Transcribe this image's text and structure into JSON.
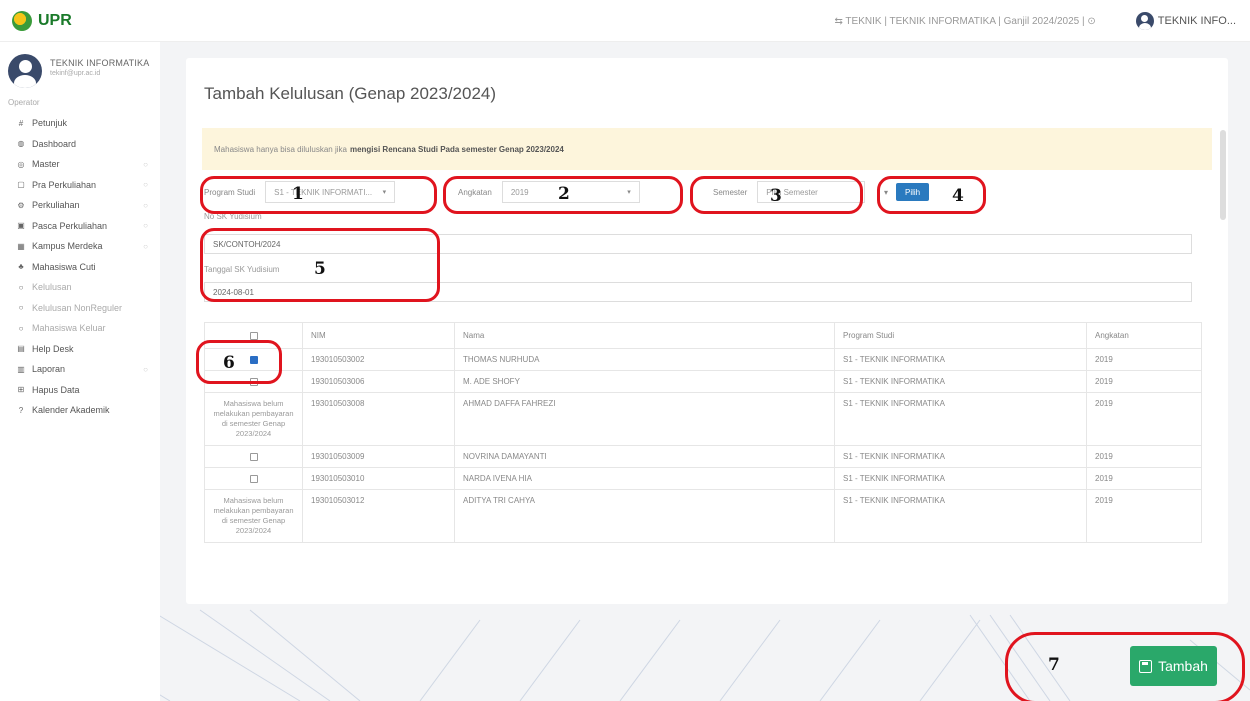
{
  "topbar": {
    "brand": "UPR",
    "info": "⇆ TEKNIK | TEKNIK INFORMATIKA | Ganjil 2024/2025 | ⊙",
    "user": "TEKNIK INFO..."
  },
  "sidebar": {
    "profile_name": "TEKNIK INFORMATIKA",
    "profile_email": "tekinf@upr.ac.id",
    "role": "Operator",
    "items": [
      {
        "icon": "#",
        "label": "Petunjuk",
        "chevron": ""
      },
      {
        "icon": "◍",
        "label": "Dashboard",
        "chevron": ""
      },
      {
        "icon": "◎",
        "label": "Master",
        "chevron": "○"
      },
      {
        "icon": "▢",
        "label": "Pra Perkuliahan",
        "chevron": "○"
      },
      {
        "icon": "⚙",
        "label": "Perkuliahan",
        "chevron": "○"
      },
      {
        "icon": "▣",
        "label": "Pasca Perkuliahan",
        "chevron": "○"
      },
      {
        "icon": "▦",
        "label": "Kampus Merdeka",
        "chevron": "○"
      },
      {
        "icon": "♣",
        "label": "Mahasiswa Cuti",
        "chevron": ""
      },
      {
        "icon": "○",
        "label": "Kelulusan",
        "chevron": ""
      },
      {
        "icon": "○",
        "label": "Kelulusan NonReguler",
        "chevron": ""
      },
      {
        "icon": "○",
        "label": "Mahasiswa Keluar",
        "chevron": ""
      },
      {
        "icon": "▤",
        "label": "Help Desk",
        "chevron": ""
      },
      {
        "icon": "▥",
        "label": "Laporan",
        "chevron": "○"
      },
      {
        "icon": "⊞",
        "label": "Hapus Data",
        "chevron": ""
      },
      {
        "icon": "?",
        "label": "Kalender Akademik",
        "chevron": ""
      }
    ]
  },
  "main": {
    "title": "Tambah Kelulusan (Genap 2023/2024)",
    "alert_prefix": "Mahasiswa hanya bisa diluluskan jika",
    "alert_bold": "mengisi Rencana Studi Pada semester Genap 2023/2024",
    "filters": {
      "prodi_label": "Program Studi",
      "prodi_value": "S1 - TEKNIK INFORMATI...",
      "angkatan_label": "Angkatan",
      "angkatan_value": "2019",
      "semester_label": "Semester",
      "semester_value": "Pilih Semester",
      "pilih_button": "Pilih"
    },
    "sk_label": "No SK Yudisium",
    "sk_value": "SK/CONTOH/2024",
    "tgl_label": "Tanggal SK Yudisium",
    "tgl_value": "2024-08-01",
    "table": {
      "headers": [
        "",
        "NIM",
        "Nama",
        "Program Studi",
        "Angkatan"
      ],
      "rows": [
        {
          "checked": true,
          "note": "",
          "nim": "193010503002",
          "nama": "THOMAS NURHUDA",
          "prodi": "S1 - TEKNIK INFORMATIKA",
          "angkatan": "2019"
        },
        {
          "checked": false,
          "note": "",
          "nim": "193010503006",
          "nama": "M. ADE SHOFY",
          "prodi": "S1 - TEKNIK INFORMATIKA",
          "angkatan": "2019"
        },
        {
          "checked": false,
          "note": "Mahasiswa belum melakukan pembayaran di semester Genap 2023/2024",
          "nim": "193010503008",
          "nama": "AHMAD DAFFA FAHREZI",
          "prodi": "S1 - TEKNIK INFORMATIKA",
          "angkatan": "2019"
        },
        {
          "checked": false,
          "note": "",
          "nim": "193010503009",
          "nama": "NOVRINA DAMAYANTI",
          "prodi": "S1 - TEKNIK INFORMATIKA",
          "angkatan": "2019"
        },
        {
          "checked": false,
          "note": "",
          "nim": "193010503010",
          "nama": "NARDA IVENA HIA",
          "prodi": "S1 - TEKNIK INFORMATIKA",
          "angkatan": "2019"
        },
        {
          "checked": false,
          "note": "Mahasiswa belum melakukan pembayaran di semester Genap 2023/2024",
          "nim": "193010503012",
          "nama": "ADITYA TRI CAHYA",
          "prodi": "S1 - TEKNIK INFORMATIKA",
          "angkatan": "2019"
        }
      ]
    },
    "tambah_button": "Tambah"
  },
  "annotations": [
    "1",
    "2",
    "3",
    "4",
    "5",
    "6",
    "7"
  ],
  "colors": {
    "brand_green": "#1a7a2a",
    "primary_blue": "#2a7abf",
    "success_green": "#2aa86a",
    "marker_red": "#e0141e",
    "alert_bg": "#fdf5dc"
  }
}
